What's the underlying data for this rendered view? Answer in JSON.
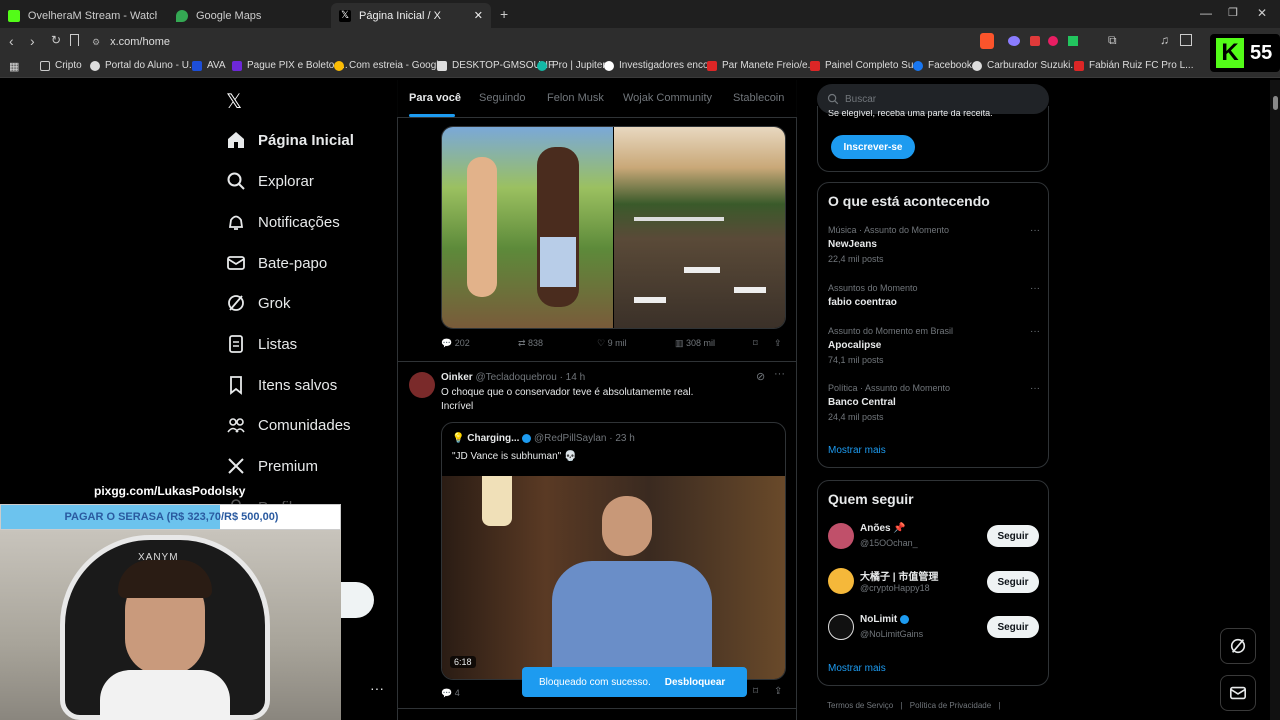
{
  "tabs": [
    {
      "title": "OvelheraM Stream - Watch Live on K"
    },
    {
      "title": "Google Maps"
    },
    {
      "title": "Página Inicial / X"
    }
  ],
  "address": "x.com/home",
  "bookmarks": [
    "Cripto",
    "Portal do Aluno - U...",
    "AVA",
    "Pague PIX e Boletos...",
    "Com estreia - Googl...",
    "DESKTOP-GMSOUHF",
    "Pro | Jupiter",
    "Investigadores enco...",
    "Par Manete Freio/e...",
    "Painel Completo Su...",
    "Facebook",
    "Carburador Suzuki...",
    "Fabián Ruiz FC Pro L..."
  ],
  "kick_badge": "55",
  "nav": [
    "Página Inicial",
    "Explorar",
    "Notificações",
    "Bate-papo",
    "Grok",
    "Listas",
    "Itens salvos",
    "Comunidades",
    "Premium"
  ],
  "nav_partial": "Perfil",
  "feed_tabs": [
    "Para você",
    "Seguindo",
    "Felon Musk",
    "Wojak Community",
    "Stablecoin"
  ],
  "post1": {
    "replies": "202",
    "reposts": "838",
    "likes": "9 mil",
    "views": "308 mil"
  },
  "post2": {
    "name": "Oinker",
    "handle": "@Tecladoquebrou",
    "time": "· 14 h",
    "text1": "O choque que o conservador teve é absolutamemte real.",
    "text2": "Incrível",
    "quote": {
      "name": "Charging...",
      "handle": "@RedPillSaylan",
      "time": "· 23 h",
      "text": "\"JD Vance is subhuman\" 💀",
      "duration": "6:18"
    },
    "replies": "4"
  },
  "toast": {
    "text": "Bloqueado com sucesso.",
    "action": "Desbloquear"
  },
  "search_placeholder": "Buscar",
  "premium_partial": "Se elegível, receba uma parte da receita.",
  "subscribe": "Inscrever-se",
  "trending": {
    "title": "O que está acontecendo",
    "items": [
      {
        "cat": "Música · Assunto do Momento",
        "name": "NewJeans",
        "posts": "22,4 mil posts"
      },
      {
        "cat": "Assuntos do Momento",
        "name": "fabio coentrao",
        "posts": ""
      },
      {
        "cat": "Assunto do Momento em Brasil",
        "name": "Apocalipse",
        "posts": "74,1 mil posts"
      },
      {
        "cat": "Política · Assunto do Momento",
        "name": "Banco Central",
        "posts": "24,4 mil posts"
      }
    ],
    "more": "Mostrar mais"
  },
  "follow": {
    "title": "Quem seguir",
    "items": [
      {
        "name": "Anões 📌",
        "handle": "@15OOchan_"
      },
      {
        "name": "大橘子 | 市值管理",
        "handle": "@cryptoHappy18"
      },
      {
        "name": "NoLimit",
        "handle": "@NoLimitGains"
      }
    ],
    "button": "Seguir",
    "more": "Mostrar mais"
  },
  "footer": [
    "Termos de Serviço",
    "|",
    "Política de Privacidade",
    "|"
  ],
  "overlay": {
    "pix": "pixgg.com/LukasPodolsky",
    "goal": "PAGAR O SERASA (R$ 323,70/R$ 500,00)",
    "goal_progress": 0.647,
    "chair": "XANYM"
  },
  "colors": {
    "accent": "#1d9bf0",
    "kick": "#53fc18"
  }
}
